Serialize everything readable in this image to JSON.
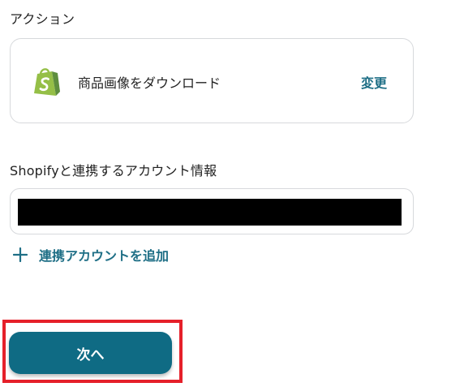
{
  "action_section": {
    "label": "アクション",
    "card": {
      "app_icon": "shopify-bag-icon",
      "action_name": "商品画像をダウンロード",
      "change_label": "変更"
    }
  },
  "account_section": {
    "label": "Shopifyと連携するアカウント情報",
    "selected_account": "",
    "add_account_icon": "plus-icon",
    "add_account_label": "連携アカウントを追加"
  },
  "footer": {
    "next_label": "次へ"
  },
  "colors": {
    "accent": "#1f6f86",
    "button": "#0f6b84",
    "shopify_green": "#95bf47",
    "highlight": "#e5202a"
  }
}
